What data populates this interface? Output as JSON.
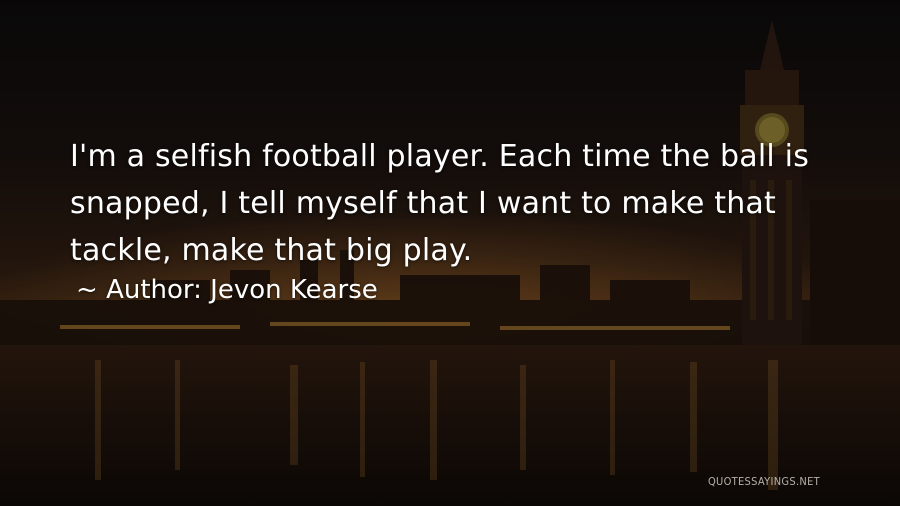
{
  "quote": {
    "lines": [
      "I'm a selfish football player. Each time the ball is",
      "snapped, I tell myself that I want to make that",
      "tackle, make that big play."
    ]
  },
  "author": {
    "prefix": "~",
    "label": "Author:",
    "name": "Jevon Kearse"
  },
  "watermark": "QUOTESSAYINGS.NET",
  "colors": {
    "text": "#ffffff",
    "sky": "#0c0a0b",
    "glow": "#3a2412",
    "water": "#120b08"
  }
}
